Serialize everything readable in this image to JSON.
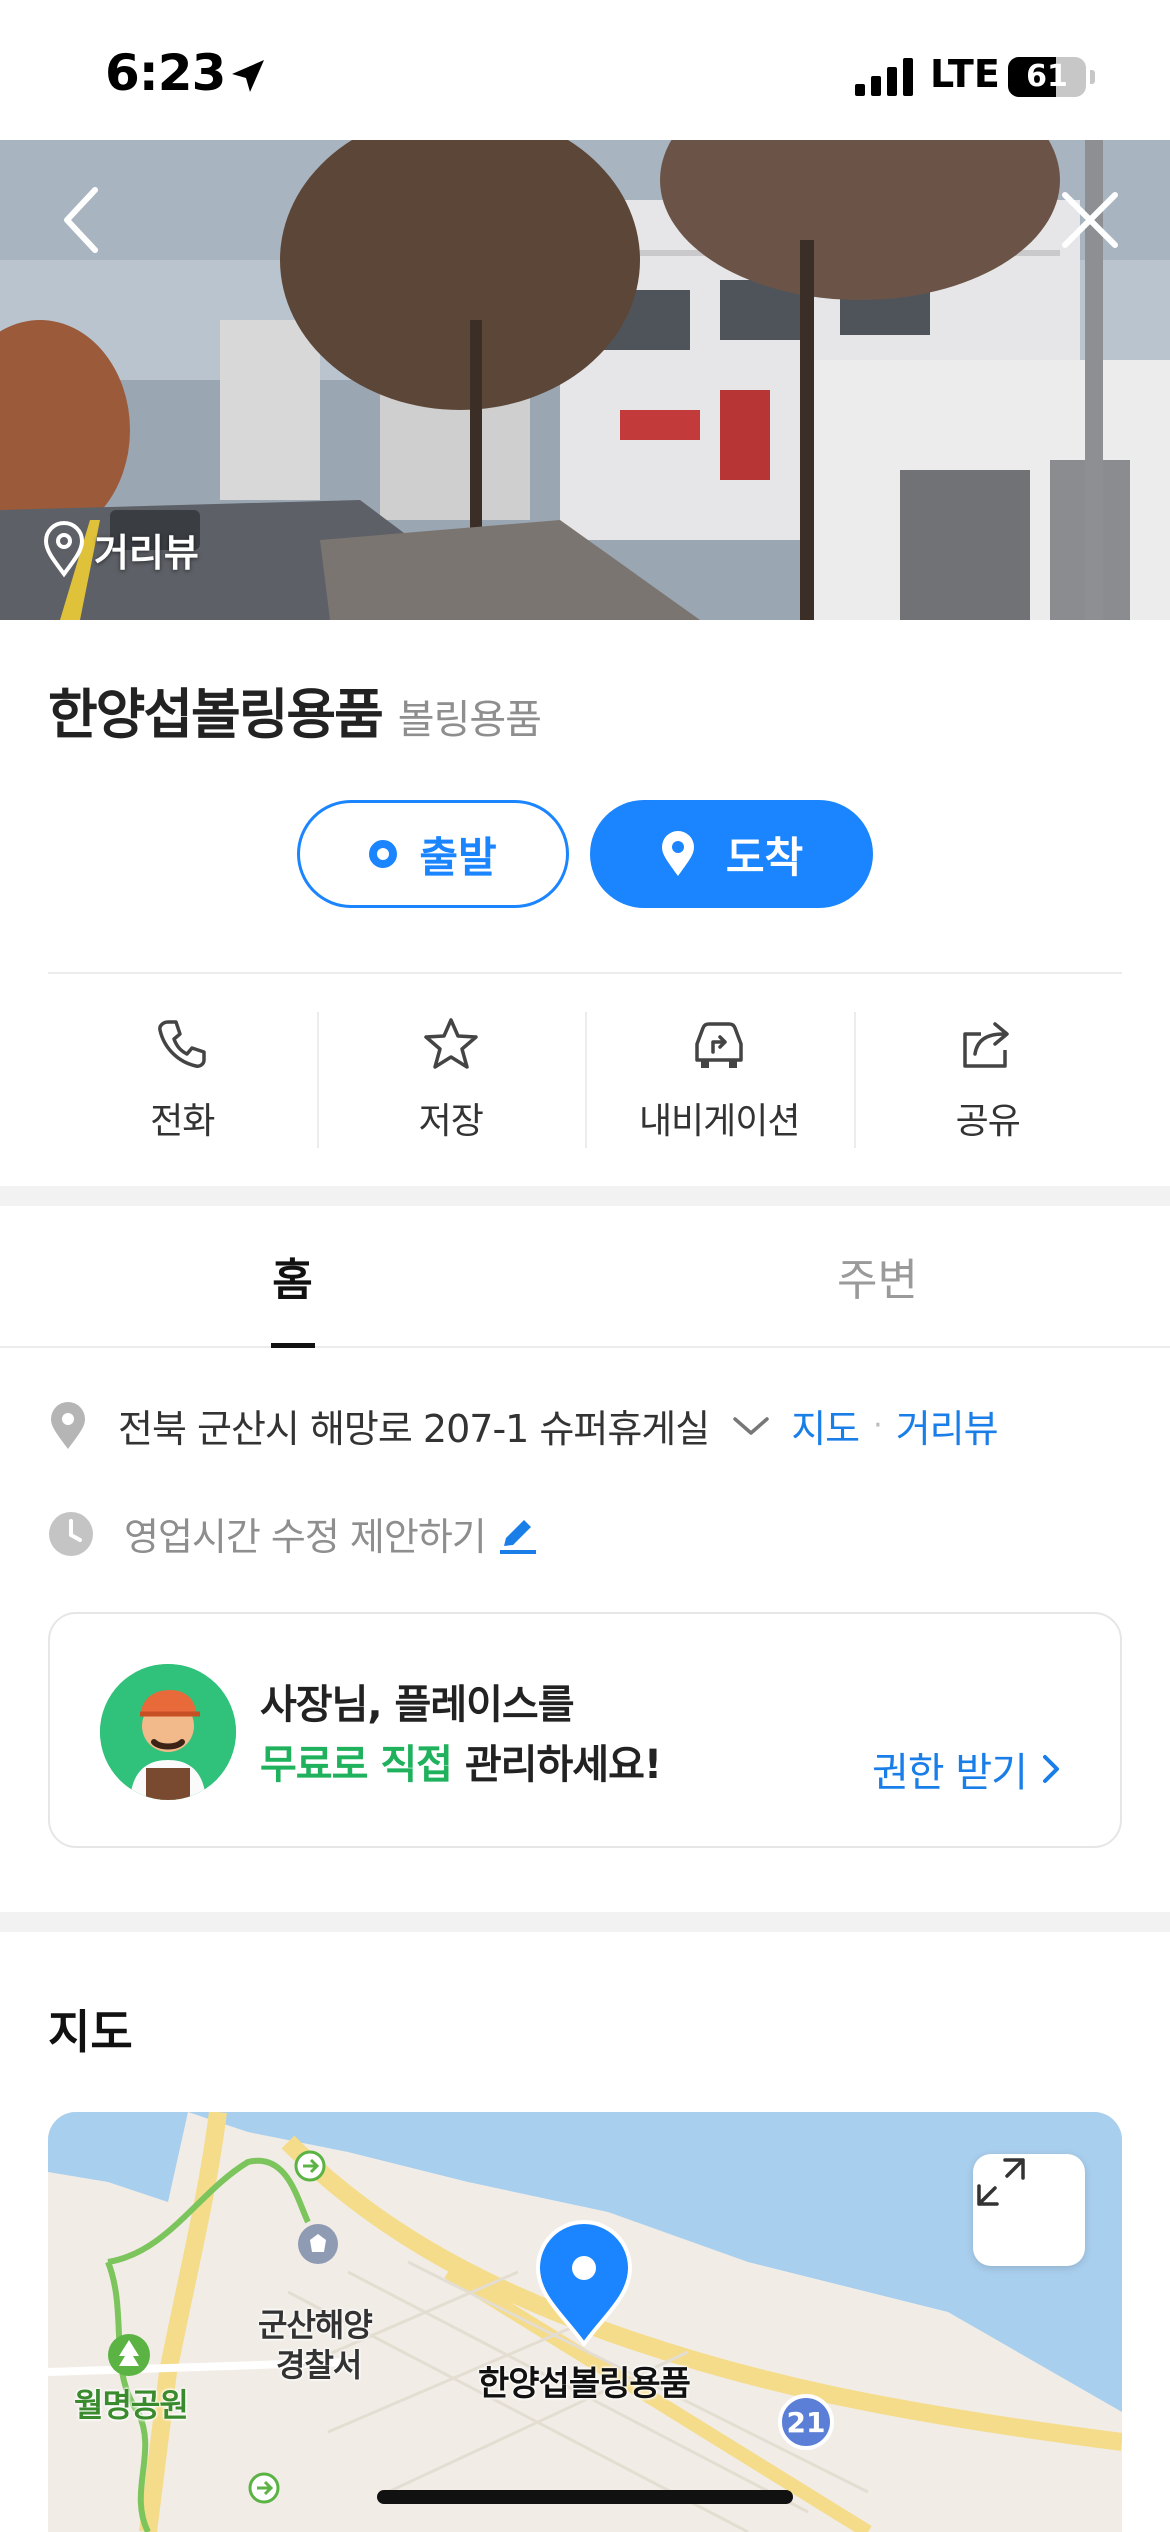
{
  "status_bar": {
    "time": "6:23",
    "network": "LTE",
    "battery": "61",
    "battery_level": 0.61
  },
  "hero": {
    "roadview_label": "거리뷰"
  },
  "place": {
    "name": "한양섭볼링용품",
    "category": "볼링용품"
  },
  "route": {
    "depart_label": "출발",
    "arrive_label": "도착"
  },
  "actions": [
    {
      "label": "전화",
      "icon": "phone-icon"
    },
    {
      "label": "저장",
      "icon": "star-icon"
    },
    {
      "label": "내비게이션",
      "icon": "car-navigation-icon"
    },
    {
      "label": "공유",
      "icon": "share-icon"
    }
  ],
  "tabs": [
    {
      "label": "홈",
      "active": true
    },
    {
      "label": "주변",
      "active": false
    }
  ],
  "info": {
    "address": "전북 군산시 해망로 207-1 슈퍼휴게실",
    "map_link": "지도",
    "separator": "·",
    "roadview_link": "거리뷰",
    "hours_text": "영업시간 수정 제안하기"
  },
  "owner_card": {
    "line1": "사장님, 플레이스를",
    "line2_highlight": "무료로 직접",
    "line2_rest": "관리하세요!",
    "link": "권한 받기"
  },
  "map_section": {
    "heading": "지도",
    "labels": {
      "police_line1": "군산해양",
      "police_line2": "경찰서",
      "park": "월명공원",
      "place": "한양섭볼링용품",
      "road_number": "21"
    }
  },
  "colors": {
    "accent": "#1a85ff",
    "link": "#1a7ee8",
    "green": "#1fb15c"
  }
}
